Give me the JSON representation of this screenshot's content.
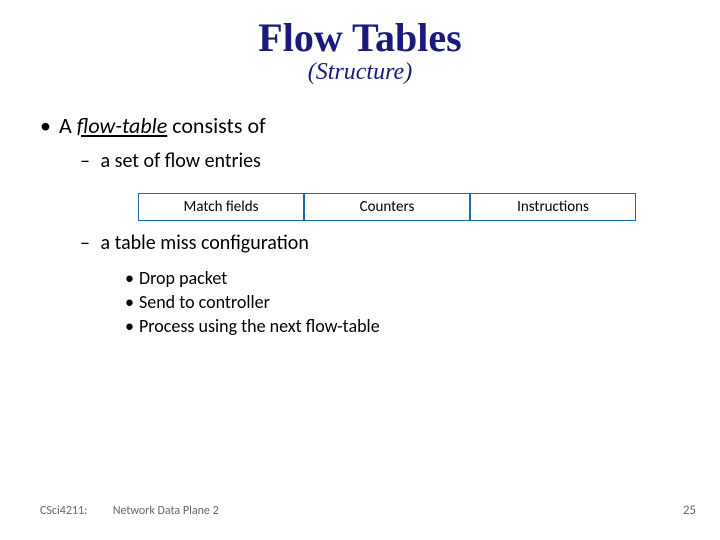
{
  "title": "Flow Tables",
  "subtitle": "(Structure)",
  "bullet1_prefix": "A ",
  "bullet1_flowtable": "flow-table",
  "bullet1_suffix": " consists of",
  "bullet2a": "a set of flow entries",
  "boxes": {
    "c0": "Match fields",
    "c1": "Counters",
    "c2": "Instructions"
  },
  "bullet2b": "a table miss configuration",
  "sub": {
    "s0": "Drop packet",
    "s1": "Send to controller",
    "s2": "Process using the next flow-table"
  },
  "footer": {
    "course": "CSci4211:",
    "topic": "Network Data Plane 2",
    "page": "25"
  }
}
